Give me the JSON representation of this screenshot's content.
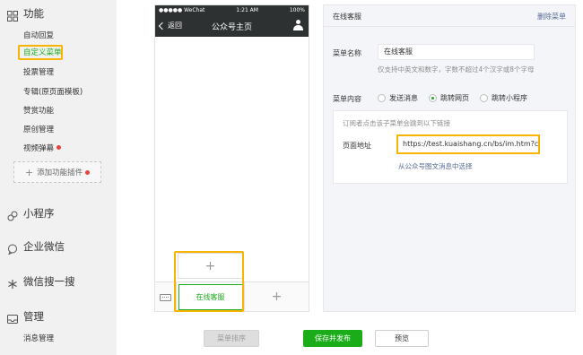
{
  "sidebar": {
    "function": {
      "title": "功能",
      "items": [
        "自动回复",
        "自定义菜单",
        "投票管理",
        "专辑(原页面模板)",
        "赞赏功能",
        "原创管理",
        "视频弹幕"
      ],
      "add_plugin": "添加功能插件"
    },
    "mini_program": "小程序",
    "enterprise_wechat": "企业微信",
    "wechat_search": "微信搜一搜",
    "manage": {
      "title": "管理",
      "items": [
        "消息管理"
      ]
    }
  },
  "phone": {
    "status": {
      "signal": "●●●●● WeChat",
      "time": "1:21 AM",
      "battery": "100%"
    },
    "back": "返回",
    "title": "公众号主页",
    "submenu_add": "+",
    "menu_item": "在线客服",
    "menu_add": "+"
  },
  "editor": {
    "title": "在线客服",
    "delete": "删除菜单",
    "name_label": "菜单名称",
    "name_value": "在线客服",
    "name_hint": "仅支持中英文和数字，字数不超过4个汉字或8个字母",
    "content_label": "菜单内容",
    "options": [
      "发送消息",
      "跳转网页",
      "跳转小程序"
    ],
    "selected": "跳转网页",
    "url_desc": "订阅者点击该子菜单会跳到以下链接",
    "url_label": "页面地址",
    "url_value": "https://test.kuaishang.cn/bs/im.htm?ca",
    "url_link": "从公众号图文消息中选择"
  },
  "actions": {
    "sort": "菜单排序",
    "save": "保存并发布",
    "preview": "预览"
  },
  "colors": {
    "accent": "#1aad19",
    "highlight": "#f8b400",
    "link": "#576b95",
    "badge": "#e64340"
  }
}
